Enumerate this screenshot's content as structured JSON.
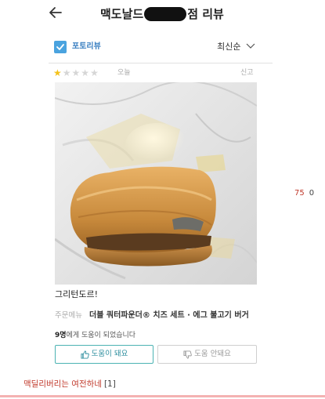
{
  "header": {
    "title_prefix": "맥도날드",
    "title_suffix": "점 리뷰",
    "back_icon": "arrow-left-icon"
  },
  "filter": {
    "photo_review_label": "포토리뷰",
    "photo_review_checked": true,
    "sort_label": "최신순",
    "sort_icon": "chevron-down-icon",
    "accent_color": "#4aa3df"
  },
  "review": {
    "rating": 1,
    "rating_max": 5,
    "date": "오늘",
    "report_label": "신고",
    "text": "그리턴도르!",
    "order_label": "주문메뉴",
    "order_items": "더블 쿼터파운더® 치즈 세트 · 에그 불고기 버거",
    "helpful_count": "9명",
    "helpful_suffix": "에게 도움이 되었습니다",
    "helpful_yes_label": "도움이 돼요",
    "helpful_no_label": "도움 안돼요"
  },
  "side_stats": {
    "views": "75",
    "comments": "0"
  },
  "post_comment": {
    "text": "맥딜리버리는 여전하네",
    "count": "[1]"
  }
}
